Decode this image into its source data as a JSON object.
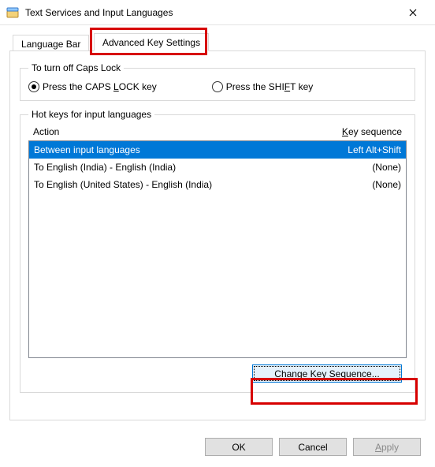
{
  "window": {
    "title": "Text Services and Input Languages"
  },
  "tabs": {
    "language_bar": "Language Bar",
    "advanced_key": "Advanced Key Settings"
  },
  "capslock": {
    "legend": "To turn off Caps Lock",
    "opt_caps_pre": "Press the CAPS ",
    "opt_caps_u": "L",
    "opt_caps_post": "OCK key",
    "opt_shift_pre": "Press the SHI",
    "opt_shift_u": "F",
    "opt_shift_post": "T key"
  },
  "hotkeys": {
    "legend": "Hot keys for input languages",
    "col_action": "Action",
    "col_seq_u": "K",
    "col_seq_post": "ey sequence",
    "rows": [
      {
        "action": "Between input languages",
        "seq": "Left Alt+Shift",
        "selected": true
      },
      {
        "action": "To English (India) - English (India)",
        "seq": "(None)",
        "selected": false
      },
      {
        "action": "To English (United States) - English (India)",
        "seq": "(None)",
        "selected": false
      }
    ],
    "change_btn_u": "C",
    "change_btn_post": "hange Key Sequence..."
  },
  "buttons": {
    "ok": "OK",
    "cancel": "Cancel",
    "apply_u": "A",
    "apply_post": "pply"
  }
}
